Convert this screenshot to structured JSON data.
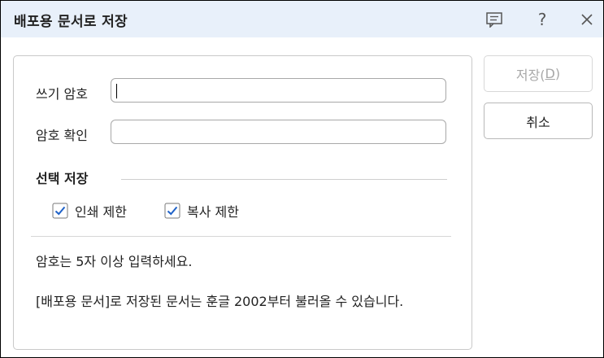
{
  "window": {
    "title": "배포용 문서로 저장",
    "comment_icon": "comment-icon",
    "help_label": "?",
    "close_icon": "close-icon"
  },
  "form": {
    "write_password_label": "쓰기 암호",
    "write_password_value": "",
    "confirm_password_label": "암호 확인",
    "confirm_password_value": ""
  },
  "options": {
    "section_title": "선택 저장",
    "print_limit_label": "인쇄 제한",
    "print_limit_checked": true,
    "copy_limit_label": "복사 제한",
    "copy_limit_checked": true
  },
  "info": {
    "line1": "암호는 5자 이상 입력하세요.",
    "line2": "[배포용 문서]로 저장된 문서는 훈글 2002부터 불러올 수 있습니다."
  },
  "buttons": {
    "save_prefix": "저장(",
    "save_mnemonic": "D",
    "save_suffix": ")",
    "save_enabled": false,
    "cancel_label": "취소"
  },
  "colors": {
    "titlebar_bg": "#e8f0fa",
    "check_accent": "#1f62c8",
    "disabled_text": "#a8a8a8"
  }
}
